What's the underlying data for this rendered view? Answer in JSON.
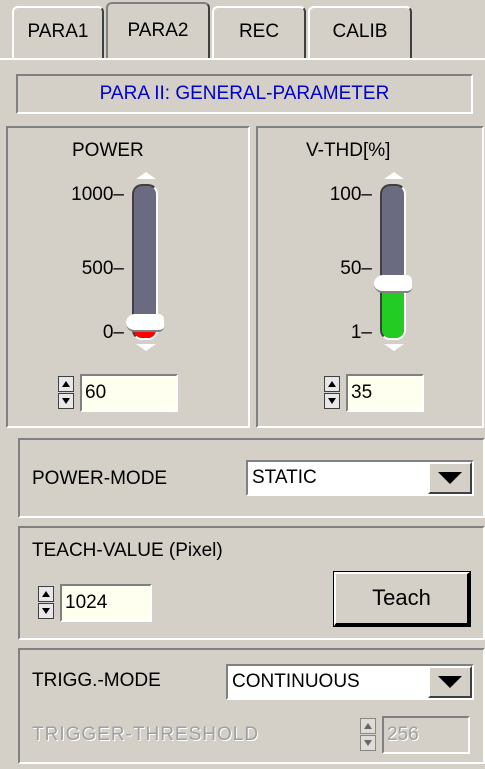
{
  "tabs": [
    {
      "label": "PARA1"
    },
    {
      "label": "PARA2",
      "active": true
    },
    {
      "label": "REC"
    },
    {
      "label": "CALIB"
    }
  ],
  "header": {
    "title": "PARA II: GENERAL-PARAMETER"
  },
  "power": {
    "label": "POWER",
    "ticks": [
      "1000–",
      "500–",
      "0–"
    ],
    "value": "60",
    "level": 0.06,
    "fill_color": "#ff0000"
  },
  "vthd": {
    "label": "V-THD[%]",
    "ticks": [
      "100–",
      "50–",
      "1–"
    ],
    "value": "35",
    "level": 0.35,
    "fill_color": "#22cc22"
  },
  "power_mode": {
    "label": "POWER-MODE",
    "selected": "STATIC"
  },
  "teach": {
    "label": "TEACH-VALUE (Pixel)",
    "value": "1024",
    "button_label": "Teach"
  },
  "trigg_mode": {
    "label": "TRIGG.-MODE",
    "selected": "CONTINUOUS"
  },
  "trigger_threshold": {
    "label": "TRIGGER-THRESHOLD",
    "value": "256"
  }
}
